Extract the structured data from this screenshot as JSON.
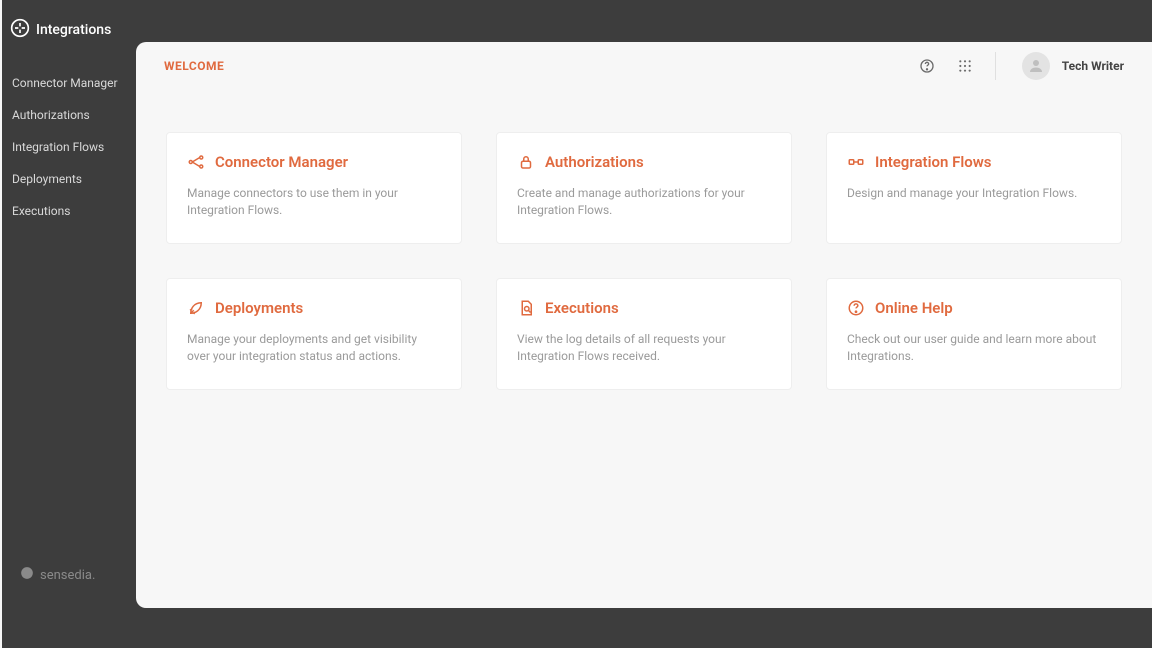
{
  "sidebar": {
    "product": "Integrations",
    "items": [
      {
        "label": "Connector Manager"
      },
      {
        "label": "Authorizations"
      },
      {
        "label": "Integration Flows"
      },
      {
        "label": "Deployments"
      },
      {
        "label": "Executions"
      }
    ],
    "footer_brand": "sensedia."
  },
  "header": {
    "title": "WELCOME",
    "user": "Tech Writer"
  },
  "cards": [
    {
      "icon": "connector-icon",
      "title": "Connector Manager",
      "desc": "Manage connectors to use them in your Integration Flows."
    },
    {
      "icon": "lock-icon",
      "title": "Authorizations",
      "desc": "Create and manage authorizations for your Integration Flows."
    },
    {
      "icon": "flow-icon",
      "title": "Integration Flows",
      "desc": "Design and manage your Integration Flows."
    },
    {
      "icon": "rocket-icon",
      "title": "Deployments",
      "desc": "Manage your deployments and get visibility over your integration status and actions."
    },
    {
      "icon": "search-doc-icon",
      "title": "Executions",
      "desc": "View the log details of all requests your Integration Flows received."
    },
    {
      "icon": "help-icon",
      "title": "Online Help",
      "desc": "Check out our user guide and learn more about Integrations."
    }
  ],
  "colors": {
    "accent": "#e06a3f",
    "bg_dark": "#3d3d3d",
    "bg_light": "#f7f7f7"
  }
}
